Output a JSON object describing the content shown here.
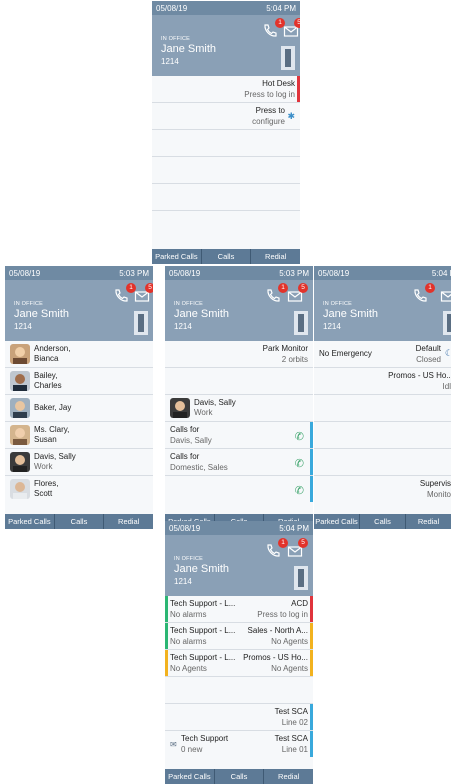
{
  "screens": {
    "top": {
      "date": "05/08/19",
      "time": "5:04 PM",
      "status": "IN OFFICE",
      "name": "Jane Smith",
      "ext": "1214",
      "calls_badge": "1",
      "mail_badge": "5",
      "rows": [
        {
          "right1": "Hot Desk",
          "right2": "Press to log in"
        },
        {
          "right1": "Press to",
          "right2": "configure"
        }
      ],
      "softkeys": [
        "Parked Calls",
        "Calls",
        "Redial"
      ]
    },
    "left": {
      "date": "05/08/19",
      "time": "5:03 PM",
      "status": "IN OFFICE",
      "name": "Jane Smith",
      "ext": "1214",
      "calls_badge": "1",
      "mail_badge": "5",
      "contacts": [
        {
          "line1": "Anderson,",
          "line2": "Bianca"
        },
        {
          "line1": "Bailey,",
          "line2": "Charles"
        },
        {
          "line1": "Baker, Jay",
          "line2": ""
        },
        {
          "line1": "Ms. Clary,",
          "line2": "Susan"
        },
        {
          "line1": "Davis, Sally",
          "line2": "Work"
        },
        {
          "line1": "Flores,",
          "line2": "Scott"
        }
      ],
      "softkeys": [
        "Parked Calls",
        "Calls",
        "Redial"
      ]
    },
    "center": {
      "date": "05/08/19",
      "time": "5:03 PM",
      "status": "IN OFFICE",
      "name": "Jane Smith",
      "ext": "1214",
      "calls_badge": "1",
      "mail_badge": "5",
      "park_title": "Park Monitor",
      "park_sub": "2 orbits",
      "contact_name": "Davis, Sally",
      "contact_sub": "Work",
      "calls_for": [
        {
          "line1": "Calls for",
          "line2": "Davis, Sally"
        },
        {
          "line1": "Calls for",
          "line2": "Domestic, Sales"
        }
      ],
      "softkeys": [
        "Parked Calls",
        "Calls",
        "Redial"
      ]
    },
    "right": {
      "date": "05/08/19",
      "time": "5:04 P",
      "status": "IN OFFICE",
      "name": "Jane Smith",
      "ext": "1214",
      "calls_badge": "1",
      "emergency": "No Emergency",
      "default_title": "Default",
      "default_sub": "Closed",
      "promos_title": "Promos - US Ho...",
      "promos_sub": "Idl",
      "super_title": "Supervis",
      "super_sub": "Monito",
      "softkeys": [
        "Parked Calls",
        "Calls",
        "Redial"
      ]
    },
    "bottom": {
      "date": "05/08/19",
      "time": "5:04 PM",
      "status": "IN OFFICE",
      "name": "Jane Smith",
      "ext": "1214",
      "calls_badge": "1",
      "mail_badge": "5",
      "rows": [
        {
          "l1": "Tech Support - L...",
          "l2": "No alarms",
          "r1": "ACD",
          "r2": "Press to log in"
        },
        {
          "l1": "Tech Support - L...",
          "l2": "No alarms",
          "r1": "Sales - North A...",
          "r2": "No Agents"
        },
        {
          "l1": "Tech Support - L...",
          "l2": "No Agents",
          "r1": "Promos - US Ho...",
          "r2": "No Agents"
        }
      ],
      "sca": [
        {
          "l1": "",
          "l2": "",
          "r1": "Test SCA",
          "r2": "Line 02"
        },
        {
          "l1": "Tech Support",
          "l2": "0 new",
          "r1": "Test SCA",
          "r2": "Line 01"
        }
      ],
      "softkeys": [
        "Parked Calls",
        "Calls",
        "Redial"
      ]
    }
  },
  "colors": {
    "red": "#e0343c",
    "green": "#2bb673",
    "yellow": "#f2b21f",
    "blue": "#39a9dc"
  }
}
